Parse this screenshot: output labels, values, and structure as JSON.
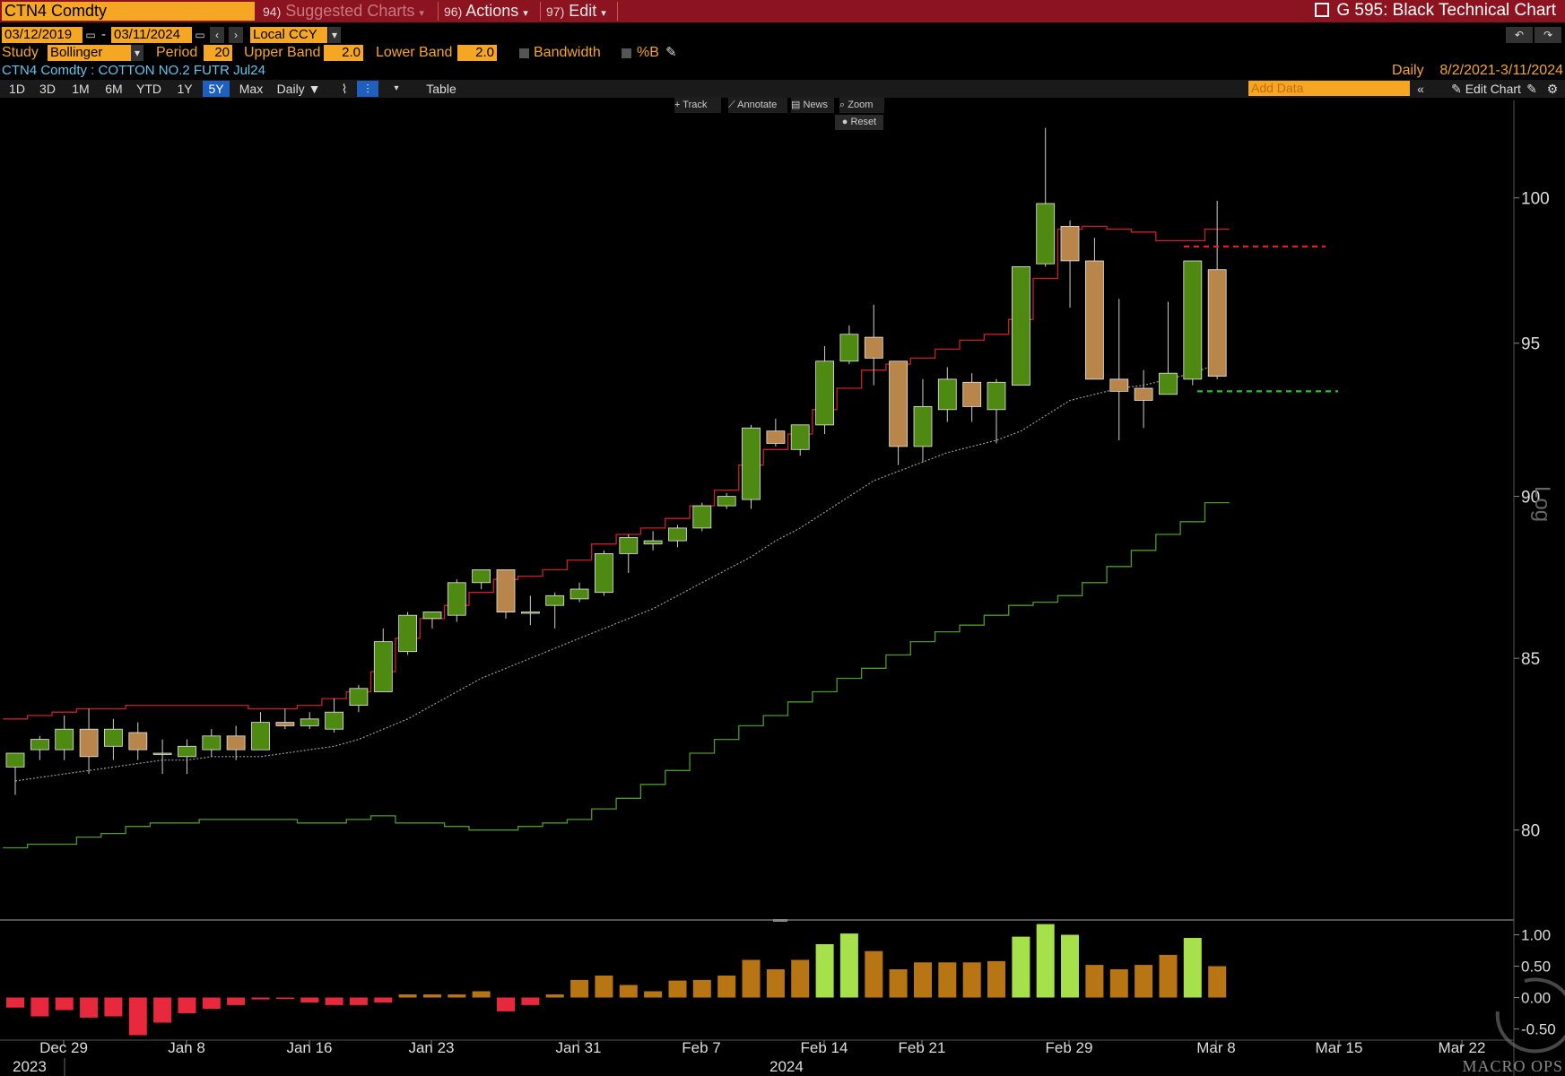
{
  "header": {
    "ticker": "CTN4 Comdty",
    "menu_suggested_num": "94)",
    "menu_suggested": "Suggested Charts",
    "menu_actions_num": "96)",
    "menu_actions": "Actions",
    "menu_edit_num": "97)",
    "menu_edit": "Edit",
    "chart_title": "G 595: Black Technical Chart"
  },
  "controls": {
    "start_date": "03/12/2019",
    "date_sep": "-",
    "end_date": "03/11/2024",
    "currency": "Local CCY",
    "study_label": "Study",
    "study_value": "Bollinger",
    "period_label": "Period",
    "period_value": "20",
    "upper_label": "Upper Band",
    "upper_value": "2.0",
    "lower_label": "Lower Band",
    "lower_value": "2.0",
    "bandwidth_label": "Bandwidth",
    "pctb_label": "%B"
  },
  "security_line": "CTN4 Comdty : COTTON NO.2 FUTR  Jul24",
  "range_label": "Daily",
  "range_dates": "8/2/2021-3/11/2024",
  "toolbar": {
    "periods": [
      "1D",
      "3D",
      "1M",
      "6M",
      "YTD",
      "1Y",
      "5Y",
      "Max"
    ],
    "active_period": "5Y",
    "frequency": "Daily",
    "table_label": "Table",
    "add_data_placeholder": "Add Data",
    "edit_chart": "Edit Chart"
  },
  "chart_tools": {
    "track": "Track",
    "annotate": "Annotate",
    "news": "News",
    "zoom": "Zoom",
    "reset": "Reset"
  },
  "watermark": "MACRO OPS",
  "colors": {
    "up_candle": "#4e8a12",
    "down_candle": "#b8864a",
    "upper_band": "#c8202a",
    "lower_band": "#4e9a1e",
    "middle_band": "#9a9a9a",
    "resistance_line": "#e02020",
    "support_line": "#30c030",
    "pctb_negative": "#e8283c",
    "pctb_mid": "#b87514",
    "pctb_high": "#a6e04a"
  },
  "chart_data": {
    "type": "candlestick",
    "y_scale": "log",
    "y_scale_label": "Log",
    "ylim": [
      77.5,
      103.5
    ],
    "y_ticks": [
      80,
      85,
      90,
      95,
      100
    ],
    "x_tick_labels": [
      "Dec 29",
      "Jan 8",
      "Jan 16",
      "Jan 23",
      "Jan 31",
      "Feb 7",
      "Feb 14",
      "Feb 21",
      "Feb 29",
      "Mar 8",
      "Mar 15",
      "Mar 22"
    ],
    "year_labels": [
      "2023",
      "2024"
    ],
    "candles": [
      {
        "o": 81.8,
        "h": 82.2,
        "l": 81.0,
        "c": 82.2
      },
      {
        "o": 82.3,
        "h": 82.7,
        "l": 82.0,
        "c": 82.6
      },
      {
        "o": 82.3,
        "h": 83.3,
        "l": 82.0,
        "c": 82.9
      },
      {
        "o": 82.9,
        "h": 83.5,
        "l": 81.6,
        "c": 82.1
      },
      {
        "o": 82.4,
        "h": 83.2,
        "l": 82.0,
        "c": 82.9
      },
      {
        "o": 82.8,
        "h": 83.1,
        "l": 82.0,
        "c": 82.3
      },
      {
        "o": 82.2,
        "h": 82.6,
        "l": 81.6,
        "c": 82.2
      },
      {
        "o": 82.1,
        "h": 82.6,
        "l": 81.6,
        "c": 82.4
      },
      {
        "o": 82.3,
        "h": 82.9,
        "l": 82.1,
        "c": 82.7
      },
      {
        "o": 82.7,
        "h": 83.0,
        "l": 82.0,
        "c": 82.3
      },
      {
        "o": 82.3,
        "h": 83.4,
        "l": 82.3,
        "c": 83.1
      },
      {
        "o": 83.1,
        "h": 83.5,
        "l": 82.9,
        "c": 83.0
      },
      {
        "o": 83.0,
        "h": 83.4,
        "l": 82.9,
        "c": 83.2
      },
      {
        "o": 82.9,
        "h": 83.8,
        "l": 82.8,
        "c": 83.4
      },
      {
        "o": 83.6,
        "h": 84.2,
        "l": 83.4,
        "c": 84.1
      },
      {
        "o": 84.0,
        "h": 85.9,
        "l": 84.0,
        "c": 85.5
      },
      {
        "o": 85.2,
        "h": 86.4,
        "l": 85.1,
        "c": 86.3
      },
      {
        "o": 86.2,
        "h": 86.4,
        "l": 85.9,
        "c": 86.4
      },
      {
        "o": 86.3,
        "h": 87.4,
        "l": 86.1,
        "c": 87.3
      },
      {
        "o": 87.3,
        "h": 87.7,
        "l": 87.1,
        "c": 87.7
      },
      {
        "o": 87.7,
        "h": 87.7,
        "l": 86.2,
        "c": 86.4
      },
      {
        "o": 86.4,
        "h": 86.9,
        "l": 86.0,
        "c": 86.4
      },
      {
        "o": 86.6,
        "h": 87.0,
        "l": 85.9,
        "c": 86.9
      },
      {
        "o": 86.8,
        "h": 87.3,
        "l": 86.7,
        "c": 87.1
      },
      {
        "o": 87.0,
        "h": 88.3,
        "l": 86.9,
        "c": 88.2
      },
      {
        "o": 88.2,
        "h": 88.8,
        "l": 87.6,
        "c": 88.7
      },
      {
        "o": 88.5,
        "h": 88.9,
        "l": 88.3,
        "c": 88.6
      },
      {
        "o": 88.6,
        "h": 89.1,
        "l": 88.4,
        "c": 89.0
      },
      {
        "o": 89.0,
        "h": 89.8,
        "l": 88.9,
        "c": 89.7
      },
      {
        "o": 89.7,
        "h": 90.1,
        "l": 89.6,
        "c": 90.0
      },
      {
        "o": 89.9,
        "h": 92.3,
        "l": 89.6,
        "c": 92.2
      },
      {
        "o": 92.1,
        "h": 92.5,
        "l": 91.6,
        "c": 91.7
      },
      {
        "o": 91.5,
        "h": 92.3,
        "l": 91.3,
        "c": 92.3
      },
      {
        "o": 92.3,
        "h": 94.9,
        "l": 92.0,
        "c": 94.4
      },
      {
        "o": 94.4,
        "h": 95.6,
        "l": 94.3,
        "c": 95.3
      },
      {
        "o": 95.2,
        "h": 96.3,
        "l": 93.6,
        "c": 94.5
      },
      {
        "o": 94.4,
        "h": 94.4,
        "l": 91.0,
        "c": 91.6
      },
      {
        "o": 91.6,
        "h": 93.8,
        "l": 91.1,
        "c": 92.9
      },
      {
        "o": 92.8,
        "h": 94.2,
        "l": 92.4,
        "c": 93.8
      },
      {
        "o": 93.7,
        "h": 94.0,
        "l": 92.4,
        "c": 92.9
      },
      {
        "o": 92.8,
        "h": 93.8,
        "l": 91.7,
        "c": 93.7
      },
      {
        "o": 93.6,
        "h": 97.6,
        "l": 93.6,
        "c": 97.6
      },
      {
        "o": 97.7,
        "h": 102.5,
        "l": 97.6,
        "c": 99.8
      },
      {
        "o": 99.0,
        "h": 99.2,
        "l": 96.2,
        "c": 97.8
      },
      {
        "o": 97.8,
        "h": 98.6,
        "l": 93.8,
        "c": 93.8
      },
      {
        "o": 93.8,
        "h": 96.5,
        "l": 91.8,
        "c": 93.4
      },
      {
        "o": 93.5,
        "h": 94.1,
        "l": 92.2,
        "c": 93.1
      },
      {
        "o": 93.3,
        "h": 96.4,
        "l": 93.3,
        "c": 94.0
      },
      {
        "o": 93.8,
        "h": 97.8,
        "l": 93.6,
        "c": 97.8
      },
      {
        "o": 97.5,
        "h": 99.9,
        "l": 93.8,
        "c": 93.9
      }
    ],
    "upper_band": [
      83.2,
      83.3,
      83.4,
      83.5,
      83.5,
      83.6,
      83.6,
      83.6,
      83.6,
      83.6,
      83.5,
      83.5,
      83.6,
      83.8,
      84.0,
      84.6,
      85.6,
      86.2,
      86.6,
      87.0,
      87.4,
      87.5,
      87.7,
      88.0,
      88.5,
      88.8,
      89.0,
      89.3,
      89.7,
      90.2,
      91.0,
      91.5,
      92.0,
      92.8,
      93.5,
      94.1,
      94.3,
      94.5,
      94.8,
      95.1,
      95.3,
      95.8,
      97.2,
      98.9,
      99.0,
      98.9,
      98.8,
      98.5,
      98.5,
      98.9
    ],
    "middle_band": [
      81.4,
      81.5,
      81.6,
      81.7,
      81.8,
      81.9,
      82.0,
      82.0,
      82.1,
      82.1,
      82.1,
      82.2,
      82.3,
      82.4,
      82.6,
      82.9,
      83.2,
      83.6,
      84.0,
      84.4,
      84.7,
      85.0,
      85.3,
      85.6,
      85.9,
      86.2,
      86.5,
      86.9,
      87.3,
      87.7,
      88.1,
      88.6,
      89.0,
      89.5,
      90.0,
      90.5,
      90.8,
      91.1,
      91.4,
      91.6,
      91.8,
      92.1,
      92.6,
      93.1,
      93.3,
      93.5,
      93.6,
      93.8,
      94.0,
      94.3
    ],
    "lower_band": [
      79.5,
      79.6,
      79.6,
      79.8,
      79.9,
      80.1,
      80.2,
      80.2,
      80.3,
      80.3,
      80.3,
      80.3,
      80.2,
      80.2,
      80.3,
      80.4,
      80.2,
      80.2,
      80.1,
      80.0,
      80.0,
      80.1,
      80.2,
      80.3,
      80.6,
      80.9,
      81.3,
      81.7,
      82.2,
      82.6,
      83.0,
      83.3,
      83.7,
      84.0,
      84.4,
      84.7,
      85.1,
      85.5,
      85.8,
      86.0,
      86.3,
      86.6,
      86.7,
      86.9,
      87.3,
      87.8,
      88.3,
      88.8,
      89.2,
      89.8
    ],
    "resistance_level": 98.3,
    "support_level": 93.4,
    "pctb_panel": {
      "ylim": [
        -0.65,
        1.15
      ],
      "y_ticks": [
        1.0,
        0.5,
        0.0,
        -0.5
      ],
      "y_tick_labels": [
        "1.00",
        "0.50",
        "0.00",
        "-0.50"
      ],
      "values": [
        -0.16,
        -0.3,
        -0.2,
        -0.32,
        -0.3,
        -0.6,
        -0.4,
        -0.25,
        -0.18,
        -0.12,
        -0.03,
        -0.02,
        -0.08,
        -0.12,
        -0.12,
        -0.08,
        0.05,
        0.05,
        0.05,
        0.1,
        -0.22,
        -0.12,
        0.05,
        0.28,
        0.35,
        0.2,
        0.1,
        0.27,
        0.28,
        0.35,
        0.6,
        0.45,
        0.6,
        0.85,
        1.02,
        0.74,
        0.45,
        0.56,
        0.56,
        0.56,
        0.58,
        0.97,
        1.17,
        1.0,
        0.52,
        0.45,
        0.52,
        0.68,
        0.95,
        0.5
      ]
    }
  }
}
